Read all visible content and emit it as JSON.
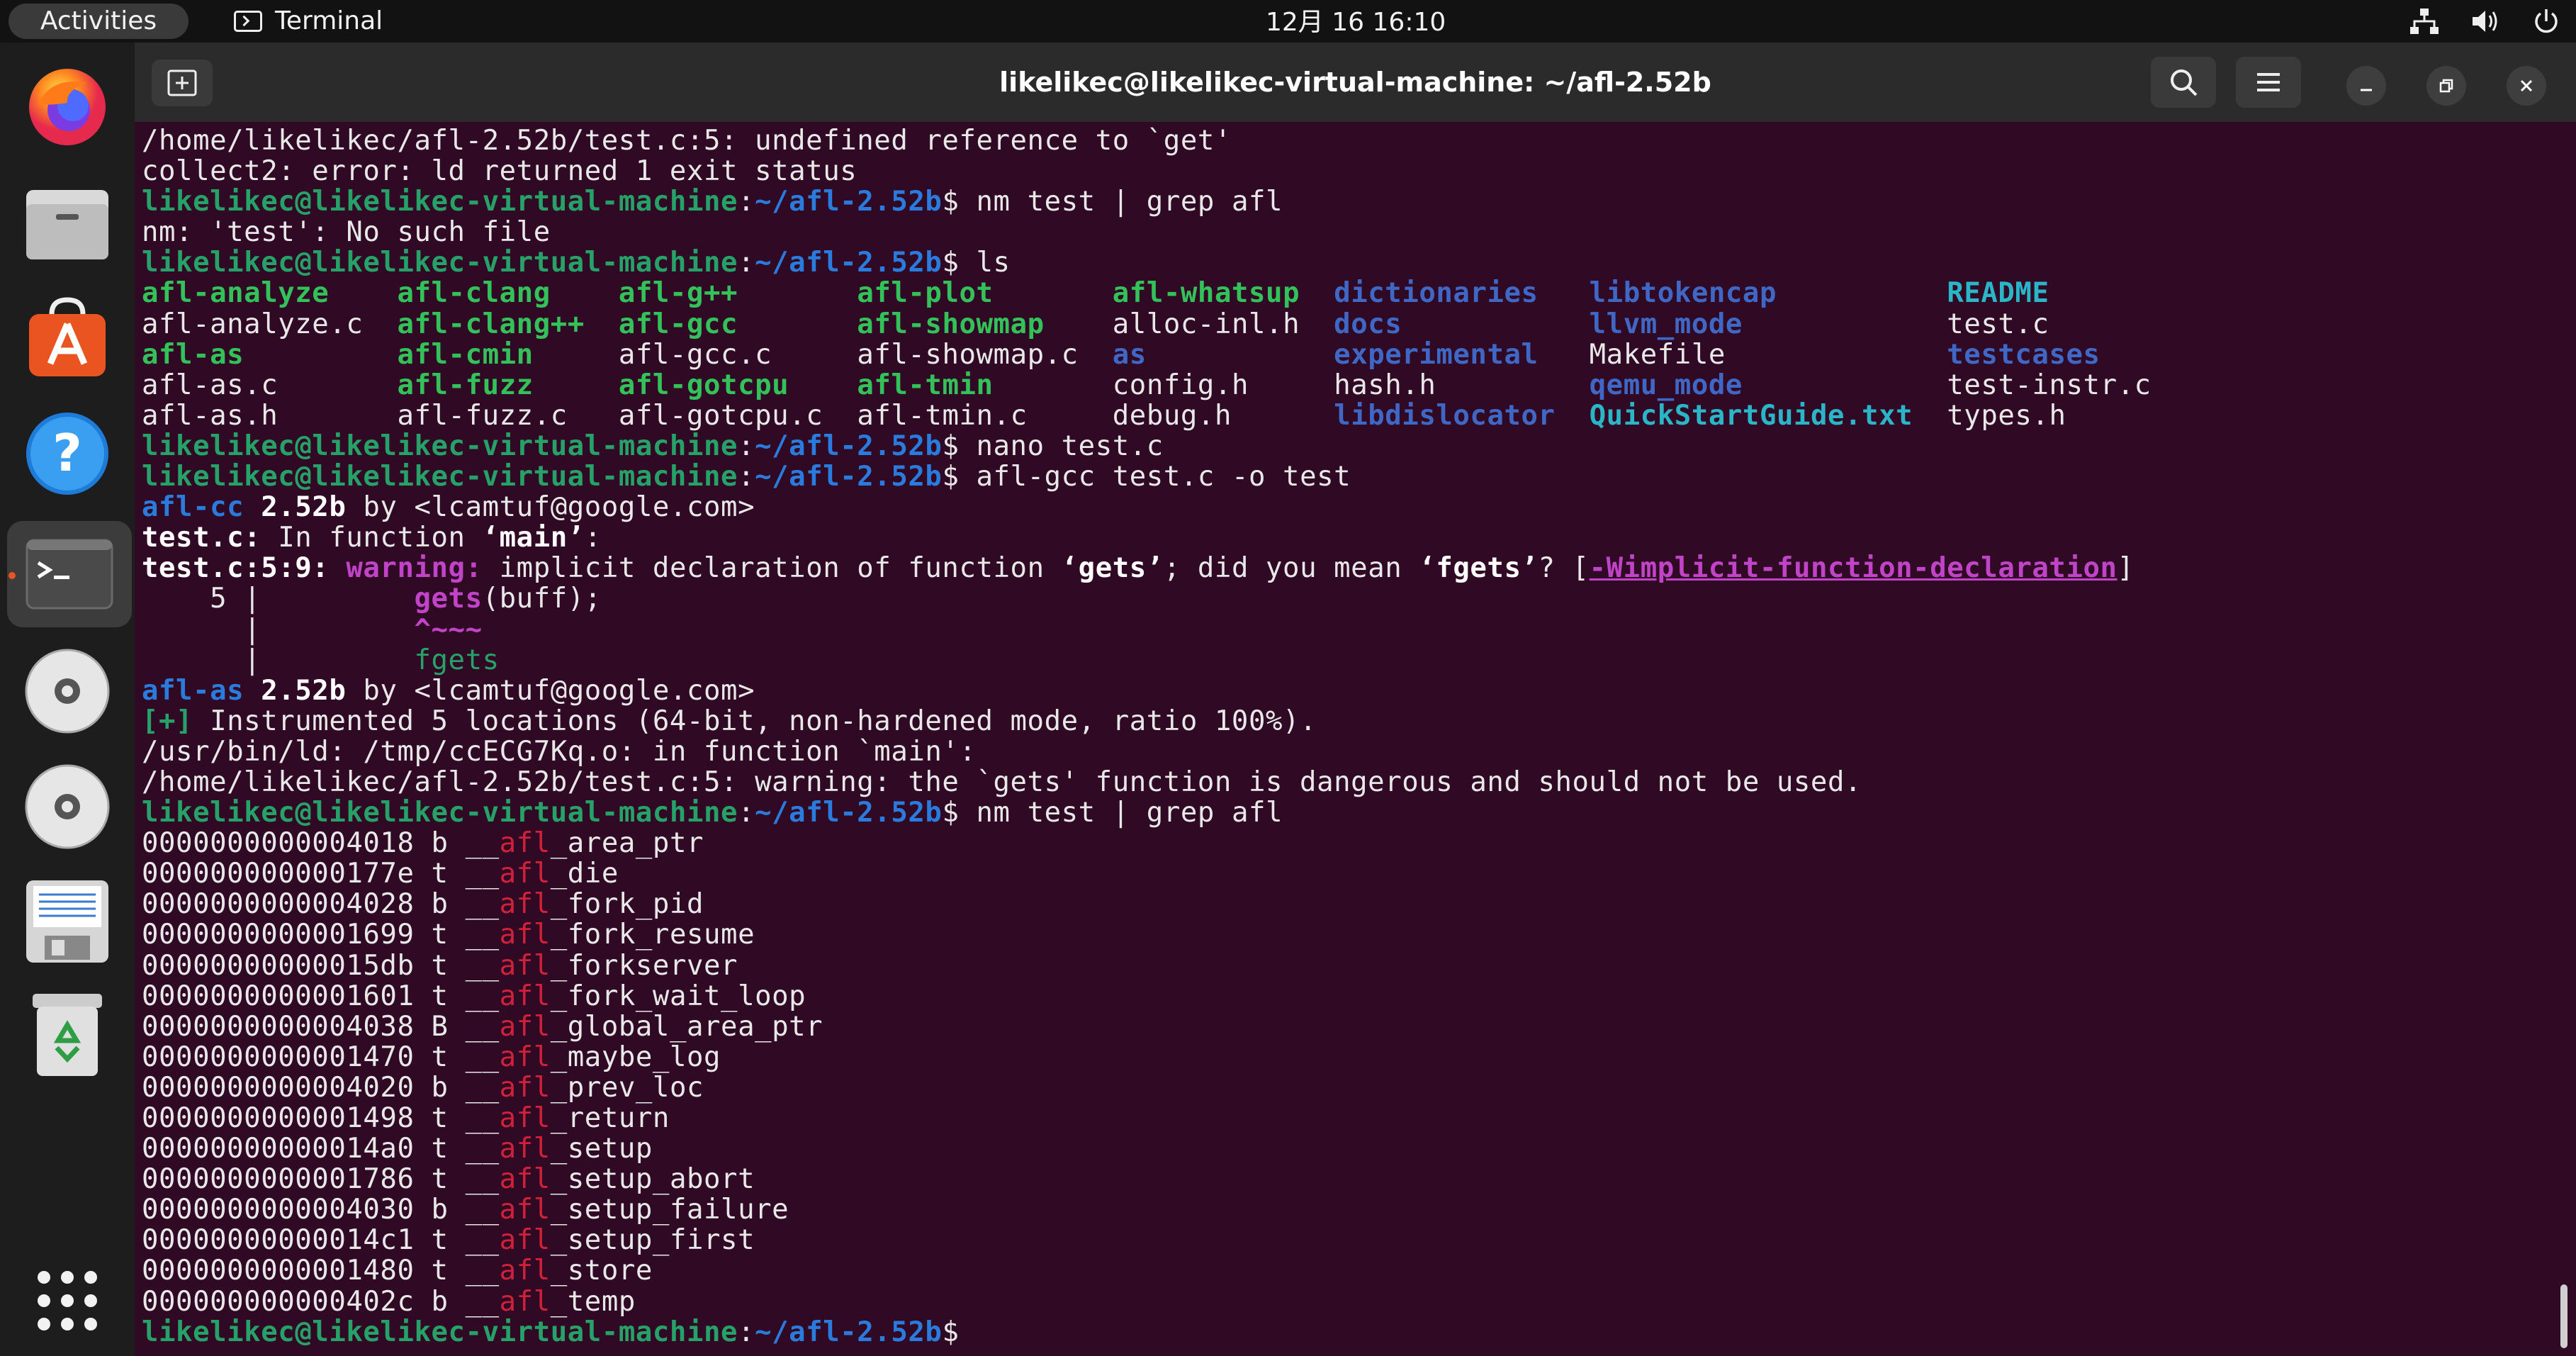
{
  "topbar": {
    "activities": "Activities",
    "app_name": "Terminal",
    "clock": "12月 16  16:10"
  },
  "dock": {
    "items": [
      "firefox-icon",
      "files-icon",
      "app-store-icon",
      "help-icon",
      "terminal-icon",
      "disc-icon",
      "disc-icon-2",
      "floppy-icon",
      "trash-icon"
    ],
    "show_apps": "show-apps-icon"
  },
  "window": {
    "title": "likelikec@likelikec-virtual-machine: ~/afl-2.52b"
  },
  "terminal": {
    "prompt_user": "likelikec@likelikec-virtual-machine",
    "prompt_path": "~/afl-2.52b",
    "l1": "/home/likelikec/afl-2.52b/test.c:5: undefined reference to `get'",
    "l2": "collect2: error: ld returned 1 exit status",
    "cmd1": " nm test | grep afl",
    "l4": "nm: 'test': No such file",
    "cmd2": " ls",
    "ls": [
      [
        [
          "afl-analyze",
          "exe"
        ],
        [
          "afl-clang",
          "exe"
        ],
        [
          "afl-g++",
          "exe"
        ],
        [
          "afl-plot",
          "exe"
        ],
        [
          "afl-whatsup",
          "exe"
        ],
        [
          "dictionaries",
          "dir"
        ],
        [
          "libtokencap",
          "dir"
        ],
        [
          "README",
          "cyan"
        ]
      ],
      [
        [
          "afl-analyze.c",
          ""
        ],
        [
          "afl-clang++",
          "exe"
        ],
        [
          "afl-gcc",
          "exe"
        ],
        [
          "afl-showmap",
          "exe"
        ],
        [
          "alloc-inl.h",
          ""
        ],
        [
          "docs",
          "dir"
        ],
        [
          "llvm_mode",
          "dir"
        ],
        [
          "test.c",
          ""
        ]
      ],
      [
        [
          "afl-as",
          "exe"
        ],
        [
          "afl-cmin",
          "exe"
        ],
        [
          "afl-gcc.c",
          ""
        ],
        [
          "afl-showmap.c",
          ""
        ],
        [
          "as",
          "dir"
        ],
        [
          "experimental",
          "dir"
        ],
        [
          "Makefile",
          ""
        ],
        [
          "testcases",
          "dir"
        ]
      ],
      [
        [
          "afl-as.c",
          ""
        ],
        [
          "afl-fuzz",
          "exe"
        ],
        [
          "afl-gotcpu",
          "exe"
        ],
        [
          "afl-tmin",
          "exe"
        ],
        [
          "config.h",
          ""
        ],
        [
          "hash.h",
          ""
        ],
        [
          "qemu_mode",
          "dir"
        ],
        [
          "test-instr.c",
          ""
        ]
      ],
      [
        [
          "afl-as.h",
          ""
        ],
        [
          "afl-fuzz.c",
          ""
        ],
        [
          "afl-gotcpu.c",
          ""
        ],
        [
          "afl-tmin.c",
          ""
        ],
        [
          "debug.h",
          ""
        ],
        [
          "libdislocator",
          "dir"
        ],
        [
          "QuickStartGuide.txt",
          "cyan"
        ],
        [
          "types.h",
          ""
        ]
      ]
    ],
    "cmd3": " nano test.c",
    "cmd4": " afl-gcc test.c -o test",
    "aflcc_name": "afl-cc",
    "aflcc_ver": "2.52b",
    "by_line": " by <lcamtuf@google.com>",
    "infunc_file": "test.c:",
    "infunc_text": " In function ",
    "infunc_main": "‘main’",
    "infunc_colon": ":",
    "warn_loc": "test.c:5:9:",
    "warn_word": "warning:",
    "warn_text_a": " implicit declaration of function ",
    "warn_gets": "‘gets’",
    "warn_text_b": "; did you mean ",
    "warn_fgets": "‘fgets’",
    "warn_text_c": "? [",
    "warn_flag": "-Wimplicit-function-declaration",
    "warn_close": "]",
    "src_lineno": "    5 |         ",
    "src_gets": "gets",
    "src_rest": "(buff);",
    "src_pipe1": "      |         ",
    "src_caret": "^~~~",
    "src_pipe2": "      |         ",
    "src_fix": "fgets",
    "aflas_name": "afl-as",
    "aflas_ver": "2.52b",
    "instr_tag": "[+]",
    "instr_text": " Instrumented 5 locations (64-bit, non-hardened mode, ratio 100%).",
    "ld1": "/usr/bin/ld: /tmp/ccECG7Kq.o: in function `main':",
    "ld2": "/home/likelikec/afl-2.52b/test.c:5: warning: the `gets' function is dangerous and should not be used.",
    "cmd5": " nm test | grep afl",
    "symbols": [
      [
        "0000000000004018",
        "b",
        "_area_ptr"
      ],
      [
        "000000000000177e",
        "t",
        "_die"
      ],
      [
        "0000000000004028",
        "b",
        "_fork_pid"
      ],
      [
        "0000000000001699",
        "t",
        "_fork_resume"
      ],
      [
        "00000000000015db",
        "t",
        "_forkserver"
      ],
      [
        "0000000000001601",
        "t",
        "_fork_wait_loop"
      ],
      [
        "0000000000004038",
        "B",
        "_global_area_ptr"
      ],
      [
        "0000000000001470",
        "t",
        "_maybe_log"
      ],
      [
        "0000000000004020",
        "b",
        "_prev_loc"
      ],
      [
        "0000000000001498",
        "t",
        "_return"
      ],
      [
        "00000000000014a0",
        "t",
        "_setup"
      ],
      [
        "0000000000001786",
        "t",
        "_setup_abort"
      ],
      [
        "0000000000004030",
        "b",
        "_setup_failure"
      ],
      [
        "00000000000014c1",
        "t",
        "_setup_first"
      ],
      [
        "0000000000001480",
        "t",
        "_store"
      ],
      [
        "000000000000402c",
        "b",
        "_temp"
      ]
    ],
    "sym_prefix": "__",
    "sym_hl": "afl",
    "dollar": "$"
  }
}
